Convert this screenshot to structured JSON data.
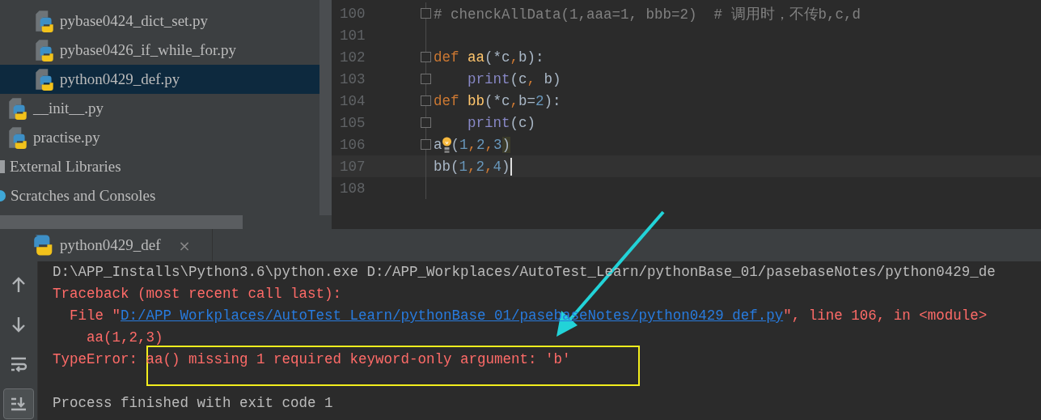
{
  "project_tree": [
    {
      "children": [
        {
          "children": [
            {
              "label": "pybase0424_dict_set.py",
              "kind": "file",
              "selected": false
            },
            {
              "label": "pybase0426_if_while_for.py",
              "kind": "file",
              "selected": false
            },
            {
              "label": "python0429_def.py",
              "kind": "file",
              "selected": true
            }
          ]
        },
        {
          "label": "__init__.py",
          "kind": "file",
          "selected": false
        },
        {
          "label": "practise.py",
          "kind": "file",
          "selected": false
        }
      ]
    },
    {
      "label": "External Libraries",
      "kind": "library",
      "selected": false
    },
    {
      "label": "Scratches and Consoles",
      "kind": "scratches",
      "selected": false
    }
  ],
  "editor": {
    "lines": [
      {
        "number": "100",
        "fold": true,
        "current": false,
        "tokens": [
          {
            "kind": "comment",
            "text": "# chenckAllData(1,aaa=1, bbb=2)  # 调用时，不传b,c,d"
          }
        ]
      },
      {
        "number": "101",
        "fold": false,
        "current": false
      },
      {
        "number": "102",
        "fold": true,
        "current": false,
        "tokens": [
          {
            "kind": "keyword",
            "text": "def "
          },
          {
            "kind": "function",
            "text": "aa"
          },
          {
            "kind": "plain",
            "text": "(*c"
          },
          {
            "kind": "keyword",
            "text": ","
          },
          {
            "kind": "plain",
            "text": "b):"
          }
        ]
      },
      {
        "number": "103",
        "fold": true,
        "current": false,
        "tokens": [
          {
            "kind": "builtin",
            "text": "    print"
          },
          {
            "kind": "plain",
            "text": "(c"
          },
          {
            "kind": "keyword",
            "text": ","
          },
          {
            "kind": "plain",
            "text": " b)"
          }
        ]
      },
      {
        "number": "104",
        "fold": true,
        "current": false,
        "tokens": [
          {
            "kind": "keyword",
            "text": "def "
          },
          {
            "kind": "function",
            "text": "bb"
          },
          {
            "kind": "plain",
            "text": "(*c"
          },
          {
            "kind": "keyword",
            "text": ","
          },
          {
            "kind": "plain",
            "text": "b="
          },
          {
            "kind": "number",
            "text": "2"
          },
          {
            "kind": "plain",
            "text": "):"
          }
        ]
      },
      {
        "number": "105",
        "fold": true,
        "current": false,
        "tokens": [
          {
            "kind": "builtin",
            "text": "    print"
          },
          {
            "kind": "plain",
            "text": "(c)"
          }
        ]
      },
      {
        "number": "106",
        "fold": true,
        "current": false,
        "bulb": true,
        "tokens": [
          {
            "kind": "plain",
            "text": "a"
          },
          {
            "kind": "plain",
            "text": "("
          },
          {
            "kind": "number",
            "text": "1"
          },
          {
            "kind": "keyword",
            "text": ","
          },
          {
            "kind": "number",
            "text": "2"
          },
          {
            "kind": "keyword",
            "text": ","
          },
          {
            "kind": "number",
            "text": "3"
          },
          {
            "kind": "brace",
            "text": ")"
          }
        ]
      },
      {
        "number": "107",
        "fold": false,
        "current": true,
        "tokens": [
          {
            "kind": "plain",
            "text": "bb("
          },
          {
            "kind": "number",
            "text": "1"
          },
          {
            "kind": "keyword",
            "text": ","
          },
          {
            "kind": "number",
            "text": "2"
          },
          {
            "kind": "keyword",
            "text": ","
          },
          {
            "kind": "number",
            "text": "4"
          },
          {
            "kind": "plain",
            "text": ")"
          }
        ]
      },
      {
        "number": "108",
        "fold": false,
        "current": false
      }
    ]
  },
  "run_panel": {
    "tab": {
      "label": "python0429_def",
      "close": "×"
    },
    "tools": [
      {
        "kind": "up",
        "selected": false
      },
      {
        "kind": "down",
        "selected": false
      },
      {
        "kind": "wrap",
        "selected": false
      },
      {
        "kind": "scroll-end",
        "selected": true
      }
    ],
    "console": [
      {
        "segments": [
          {
            "kind": "plain",
            "text": "D:\\APP_Installs\\Python3.6\\python.exe D:/APP_Workplaces/AutoTest_Learn/pythonBase_01/pasebaseNotes/python0429_de"
          }
        ]
      },
      {
        "segments": [
          {
            "kind": "error",
            "text": "Traceback (most recent call last):"
          }
        ]
      },
      {
        "segments": [
          {
            "kind": "error",
            "text": "  File \""
          },
          {
            "kind": "link",
            "text": "D:/APP_Workplaces/AutoTest_Learn/pythonBase_01/pasebaseNotes/python0429_def.py"
          },
          {
            "kind": "error",
            "text": "\", line 106, in <module>"
          }
        ]
      },
      {
        "segments": [
          {
            "kind": "error",
            "text": "    aa(1,2,3)"
          }
        ]
      },
      {
        "segments": [
          {
            "kind": "error",
            "text": "TypeError: aa() missing 1 required keyword-only argument: 'b'"
          }
        ]
      },
      {
        "segments": [
          {
            "kind": "plain",
            "text": "Process finished with exit code 1"
          }
        ]
      }
    ]
  }
}
